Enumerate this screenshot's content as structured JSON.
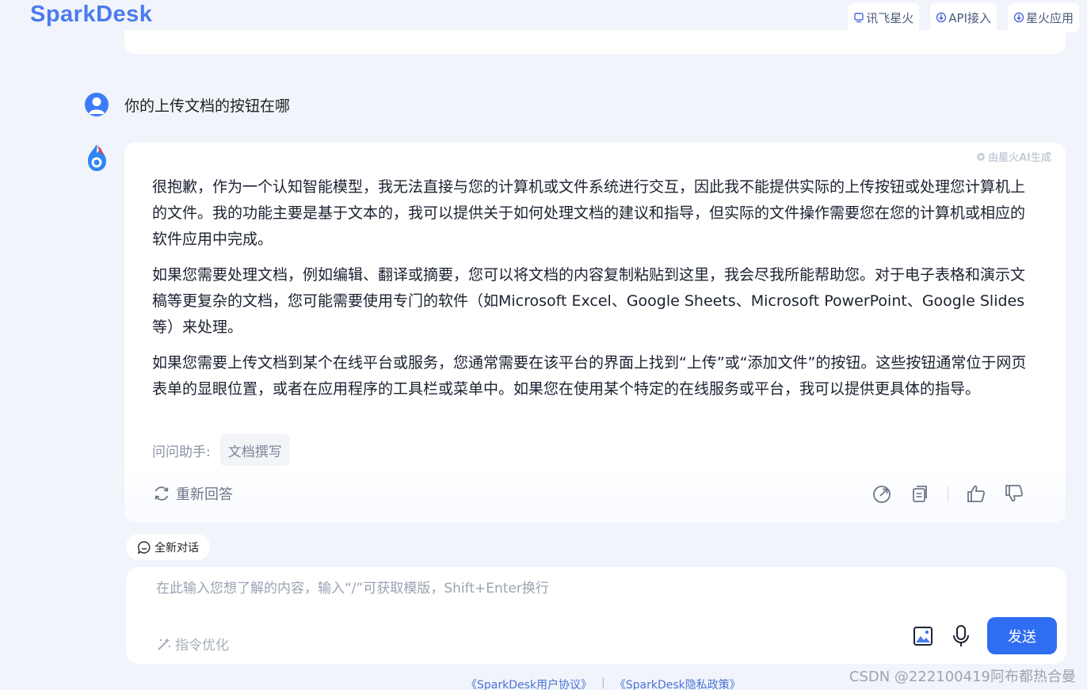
{
  "header": {
    "logo": "SparkDesk",
    "links": [
      {
        "label": "讯飞星火",
        "icon": "monitor-icon"
      },
      {
        "label": "API接入",
        "icon": "api-icon"
      },
      {
        "label": "星火应用",
        "icon": "app-icon"
      }
    ]
  },
  "conversation": {
    "user_question": "你的上传文档的按钮在哪",
    "ai_badge": "由星火AI生成",
    "answer_paragraphs": [
      "很抱歉，作为一个认知智能模型，我无法直接与您的计算机或文件系统进行交互，因此我不能提供实际的上传按钮或处理您计算机上的文件。我的功能主要是基于文本的，我可以提供关于如何处理文档的建议和指导，但实际的文件操作需要您在您的计算机或相应的软件应用中完成。",
      "如果您需要处理文档，例如编辑、翻译或摘要，您可以将文档的内容复制粘贴到这里，我会尽我所能帮助您。对于电子表格和演示文稿等更复杂的文档，您可能需要使用专门的软件（如Microsoft Excel、Google Sheets、Microsoft PowerPoint、Google Slides等）来处理。",
      "如果您需要上传文档到某个在线平台或服务，您通常需要在该平台的界面上找到“上传”或“添加文件”的按钮。这些按钮通常位于网页表单的显眼位置，或者在应用程序的工具栏或菜单中。如果您在使用某个特定的在线服务或平台，我可以提供更具体的指导。"
    ],
    "ask_label": "问问助手:",
    "ask_chip": "文档撰写",
    "regenerate_label": "重新回答"
  },
  "composer": {
    "new_chat_label": "全新对话",
    "placeholder": "在此输入您想了解的内容，输入“/”可获取模版，Shift+Enter换行",
    "optimize_label": "指令优化",
    "send_label": "发送"
  },
  "footer": {
    "agreement": "《SparkDesk用户协议》",
    "separator": "|",
    "privacy": "《SparkDesk隐私政策》"
  },
  "watermark": "CSDN @222100419阿布都热合曼",
  "colors": {
    "brand": "#4c7bf0",
    "send_button": "#2f6df3",
    "background": "#f1f4fa"
  }
}
